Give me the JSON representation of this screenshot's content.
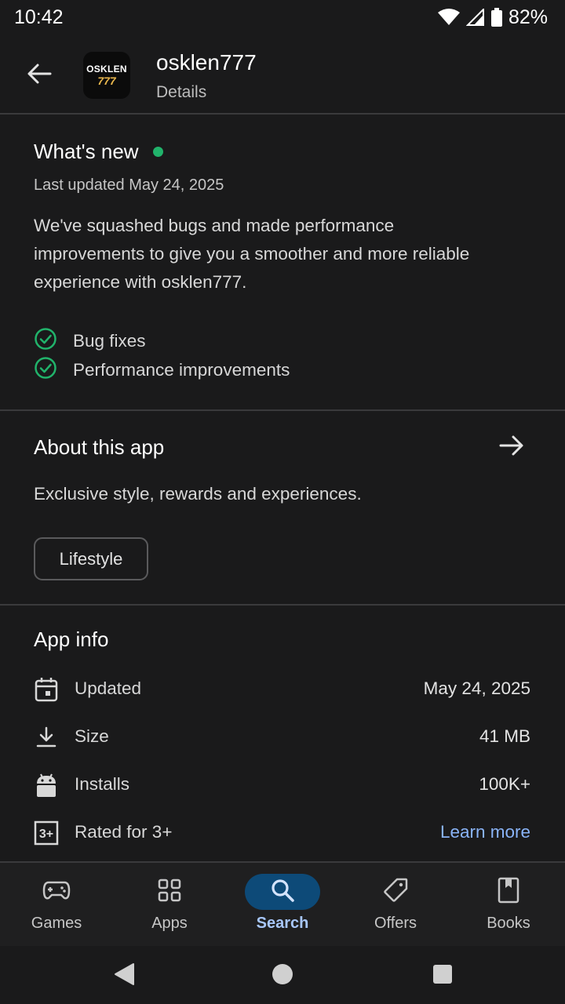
{
  "status_bar": {
    "time": "10:42",
    "battery": "82%"
  },
  "header": {
    "back_icon": "arrow-back-icon",
    "app_icon_line1": "OSKLEN",
    "app_icon_line2": "777",
    "app_name": "osklen777",
    "subtitle": "Details"
  },
  "whats_new": {
    "title": "What's new",
    "last_updated": "Last updated May 24, 2025",
    "description": "We've squashed bugs and made performance improvements to give you a smoother and more reliable experience with osklen777.",
    "items": [
      {
        "label": "Bug fixes",
        "icon": "check-circle-icon"
      },
      {
        "label": "Performance improvements",
        "icon": "check-circle-icon"
      }
    ],
    "dot_color": "#21b36b"
  },
  "about": {
    "title": "About this app",
    "description": "Exclusive style, rewards and experiences.",
    "category_chip": "Lifestyle"
  },
  "app_info": {
    "title": "App info",
    "rows": [
      {
        "icon": "calendar-icon",
        "label": "Updated",
        "value": "May 24, 2025"
      },
      {
        "icon": "download-icon",
        "label": "Size",
        "value": "41 MB"
      },
      {
        "icon": "android-icon",
        "label": "Installs",
        "value": "100K+"
      },
      {
        "icon": "rating-3plus-icon",
        "label": "Rated for 3+",
        "value": "Learn more"
      }
    ]
  },
  "bottom_nav": {
    "items": [
      {
        "label": "Games",
        "icon": "gamepad-icon"
      },
      {
        "label": "Apps",
        "icon": "apps-grid-icon"
      },
      {
        "label": "Search",
        "icon": "search-icon",
        "active": true
      },
      {
        "label": "Offers",
        "icon": "tag-icon"
      },
      {
        "label": "Books",
        "icon": "book-icon"
      }
    ]
  },
  "colors": {
    "background": "#1a1a1b",
    "accent_link": "#8ab4f8",
    "active_nav_pill": "#0d4a78",
    "check_green": "#21b36b"
  }
}
